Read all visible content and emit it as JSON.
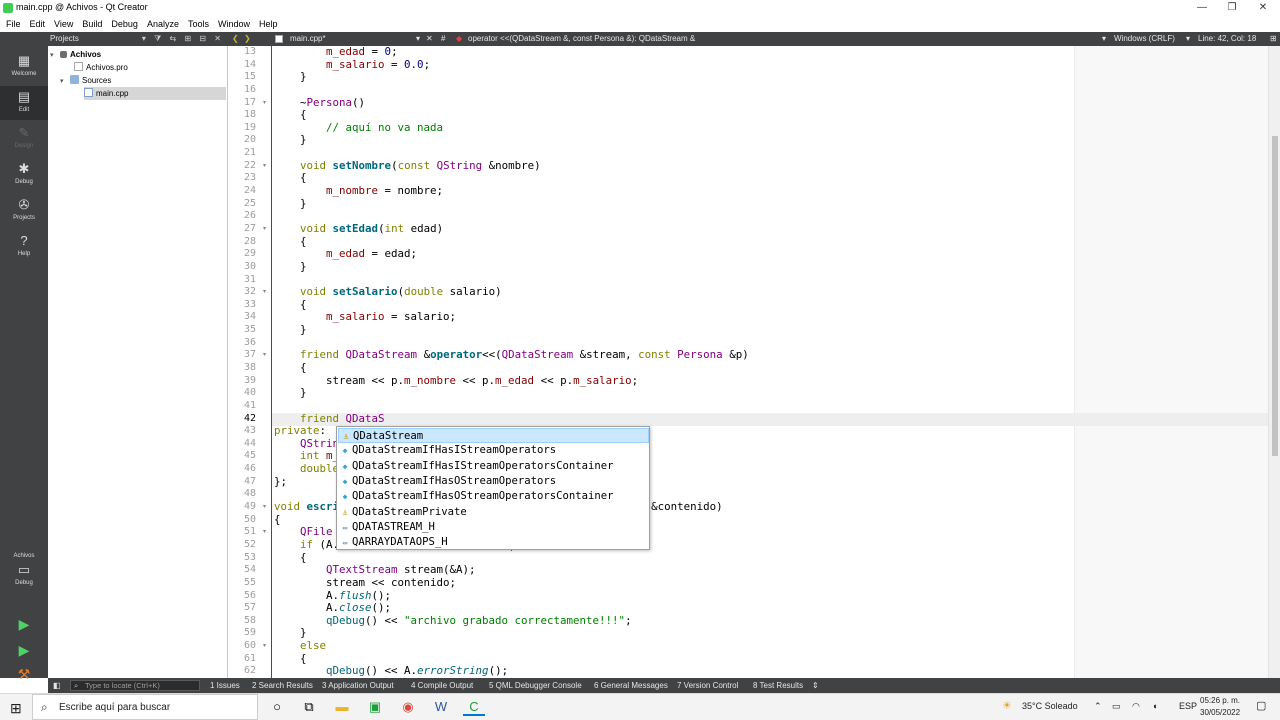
{
  "window": {
    "title": "main.cpp @ Achivos - Qt Creator",
    "controls": [
      "—",
      "❐",
      "✕"
    ]
  },
  "menu": [
    "File",
    "Edit",
    "View",
    "Build",
    "Debug",
    "Analyze",
    "Tools",
    "Window",
    "Help"
  ],
  "modes": [
    {
      "label": "Welcome",
      "icon": "grid-icon"
    },
    {
      "label": "Edit",
      "icon": "edit-icon"
    },
    {
      "label": "Design",
      "icon": "pencil-icon"
    },
    {
      "label": "Debug",
      "icon": "bug-icon"
    },
    {
      "label": "Projects",
      "icon": "wrench-icon"
    },
    {
      "label": "Help",
      "icon": "help-icon"
    }
  ],
  "kit": {
    "project": "Achivos",
    "config": "Debug"
  },
  "projects": {
    "header": "Projects",
    "tree": {
      "root": "Achivos",
      "pro_file": "Achivos.pro",
      "sources_label": "Sources",
      "source_file": "main.cpp"
    }
  },
  "editor_toolbar": {
    "file": "main.cpp*",
    "hash": "#",
    "symbol": "operator <<(QDataStream &, const Persona &): QDataStream &",
    "line_endings": "Windows (CRLF)",
    "position": "Line: 42, Col: 18"
  },
  "code": {
    "first_line": 13,
    "current_line": 42
  },
  "completion": {
    "items": [
      {
        "text": "QDataStream",
        "kind": "class"
      },
      {
        "text": "QDataStreamIfHasIStreamOperators",
        "kind": "struct"
      },
      {
        "text": "QDataStreamIfHasIStreamOperatorsContainer",
        "kind": "struct"
      },
      {
        "text": "QDataStreamIfHasOStreamOperators",
        "kind": "struct"
      },
      {
        "text": "QDataStreamIfHasOStreamOperatorsContainer",
        "kind": "struct"
      },
      {
        "text": "QDataStreamPrivate",
        "kind": "class"
      },
      {
        "text": "QDATASTREAM_H",
        "kind": "macro"
      },
      {
        "text": "QARRAYDATAOPS_H",
        "kind": "macro"
      }
    ]
  },
  "output_panes": {
    "locator_placeholder": "Type to locate (Ctrl+K)",
    "tabs": [
      "1  Issues",
      "2  Search Results",
      "3  Application Output",
      "4  Compile Output",
      "5  QML Debugger Console",
      "6  General Messages",
      "7  Version Control",
      "8  Test Results"
    ]
  },
  "taskbar": {
    "search_placeholder": "Escribe aquí para buscar",
    "weather": "35°C  Soleado",
    "language": "ESP",
    "time": "05:26 p. m.",
    "date": "30/05/2022"
  }
}
